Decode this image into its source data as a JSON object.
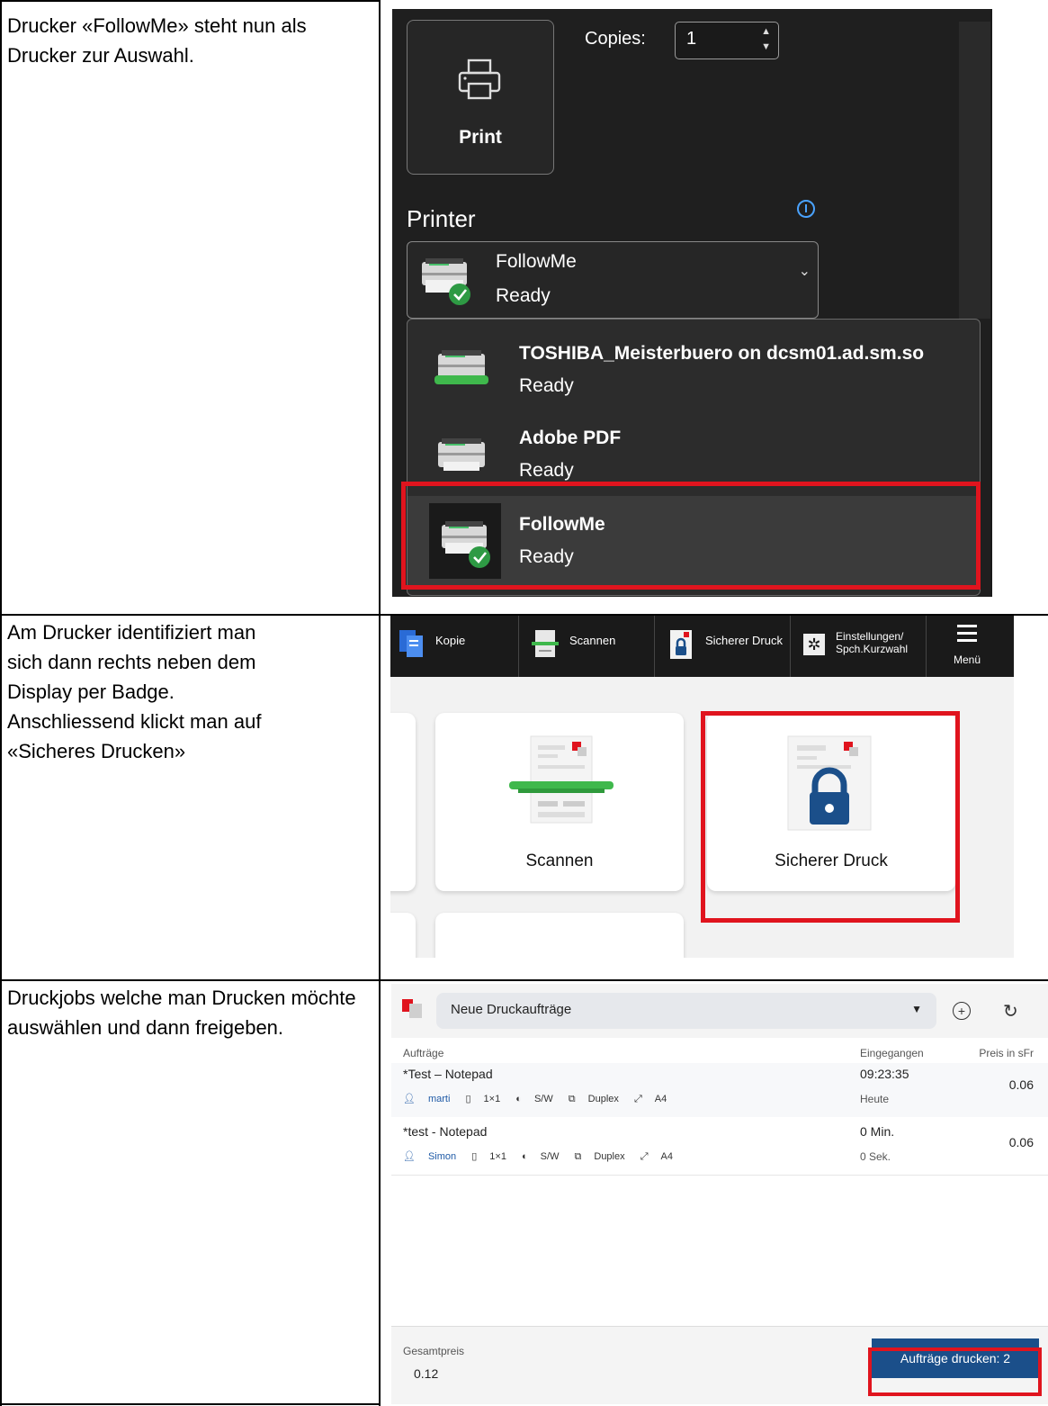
{
  "steps": [
    {
      "text": "Drucker «FollowMe» steht nun als Drucker zur Auswahl."
    },
    {
      "lines": [
        "Am Drucker identifiziert man",
        "sich dann rechts neben dem",
        "Display per Badge.",
        "Anschliessend klickt man auf",
        "«Sicheres Drucken»"
      ]
    },
    {
      "text": "Druckjobs welche man Drucken möchte auswählen und dann freigeben."
    }
  ],
  "print_dialog": {
    "print_label": "Print",
    "copies_label": "Copies:",
    "copies_value": "1",
    "printer_label": "Printer",
    "selected": {
      "name": "FollowMe",
      "status": "Ready"
    },
    "options": [
      {
        "name": "TOSHIBA_Meisterbuero on dcsm01.ad.sm.so",
        "status": "Ready"
      },
      {
        "name": "Adobe PDF",
        "status": "Ready"
      },
      {
        "name": "FollowMe",
        "status": "Ready"
      }
    ]
  },
  "printer_panel": {
    "tabs": [
      {
        "label": "Kopie"
      },
      {
        "label": "Scannen"
      },
      {
        "label": "Sicherer Druck"
      },
      {
        "label": "Einstellungen/\nSpch.Kurzwahl"
      }
    ],
    "menu_label": "Menü",
    "tiles": [
      {
        "label": "Scannen"
      },
      {
        "label": "Sicherer Druck"
      }
    ]
  },
  "job_list": {
    "dropdown": "Neue Druckaufträge",
    "headers": {
      "jobs": "Aufträge",
      "received": "Eingegangen",
      "price": "Preis in sFr"
    },
    "jobs": [
      {
        "name": "*Test – Notepad",
        "user": "marti",
        "pages": "1×1",
        "color": "S/W",
        "duplex": "Duplex",
        "paper": "A4",
        "time": "09:23:35",
        "sub": "Heute",
        "price": "0.06"
      },
      {
        "name": "*test - Notepad",
        "user": "Simon",
        "pages": "1×1",
        "color": "S/W",
        "duplex": "Duplex",
        "paper": "A4",
        "time": "0 Min.",
        "sub": "0 Sek.",
        "price": "0.06"
      }
    ],
    "total_label": "Gesamtpreis",
    "total_value": "0.12",
    "print_button": "Aufträge drucken: 2"
  },
  "colors": {
    "highlight": "#e0141e",
    "button": "#1b4f8a",
    "dialog_bg": "#1f1f1f"
  }
}
